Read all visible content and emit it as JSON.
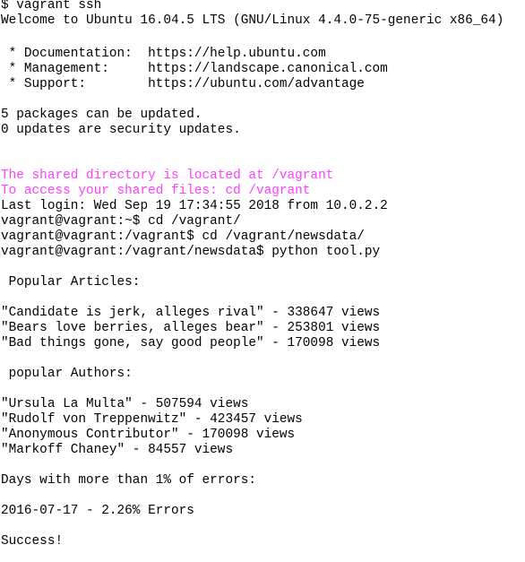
{
  "terminal": {
    "lines": [
      {
        "text": "$ vagrant ssh",
        "style": "normal"
      },
      {
        "text": "Welcome to Ubuntu 16.04.5 LTS (GNU/Linux 4.4.0-75-generic x86_64)",
        "style": "normal"
      },
      {
        "text": "",
        "style": "normal"
      },
      {
        "text": " * Documentation:  https://help.ubuntu.com",
        "style": "normal"
      },
      {
        "text": " * Management:     https://landscape.canonical.com",
        "style": "normal"
      },
      {
        "text": " * Support:        https://ubuntu.com/advantage",
        "style": "normal"
      },
      {
        "text": "",
        "style": "normal"
      },
      {
        "text": "5 packages can be updated.",
        "style": "normal"
      },
      {
        "text": "0 updates are security updates.",
        "style": "normal"
      },
      {
        "text": "",
        "style": "normal"
      },
      {
        "text": "",
        "style": "normal"
      },
      {
        "text": "The shared directory is located at /vagrant",
        "style": "magenta"
      },
      {
        "text": "To access your shared files: cd /vagrant",
        "style": "magenta"
      },
      {
        "text": "Last login: Wed Sep 19 17:34:55 2018 from 10.0.2.2",
        "style": "normal"
      },
      {
        "text": "vagrant@vagrant:~$ cd /vagrant/",
        "style": "normal"
      },
      {
        "text": "vagrant@vagrant:/vagrant$ cd /vagrant/newsdata/",
        "style": "normal"
      },
      {
        "text": "vagrant@vagrant:/vagrant/newsdata$ python tool.py",
        "style": "normal"
      },
      {
        "text": "",
        "style": "normal"
      },
      {
        "text": " Popular Articles:",
        "style": "normal"
      },
      {
        "text": "",
        "style": "normal"
      },
      {
        "text": "\"Candidate is jerk, alleges rival\" - 338647 views",
        "style": "normal"
      },
      {
        "text": "\"Bears love berries, alleges bear\" - 253801 views",
        "style": "normal"
      },
      {
        "text": "\"Bad things gone, say good people\" - 170098 views",
        "style": "normal"
      },
      {
        "text": "",
        "style": "normal"
      },
      {
        "text": " popular Authors:",
        "style": "normal"
      },
      {
        "text": "",
        "style": "normal"
      },
      {
        "text": "\"Ursula La Multa\" - 507594 views",
        "style": "normal"
      },
      {
        "text": "\"Rudolf von Treppenwitz\" - 423457 views",
        "style": "normal"
      },
      {
        "text": "\"Anonymous Contributor\" - 170098 views",
        "style": "normal"
      },
      {
        "text": "\"Markoff Chaney\" - 84557 views",
        "style": "normal"
      },
      {
        "text": "",
        "style": "normal"
      },
      {
        "text": "Days with more than 1% of errors:",
        "style": "normal"
      },
      {
        "text": "",
        "style": "normal"
      },
      {
        "text": "2016-07-17 - 2.26% Errors",
        "style": "normal"
      },
      {
        "text": "",
        "style": "normal"
      },
      {
        "text": "Success!",
        "style": "normal"
      }
    ]
  }
}
